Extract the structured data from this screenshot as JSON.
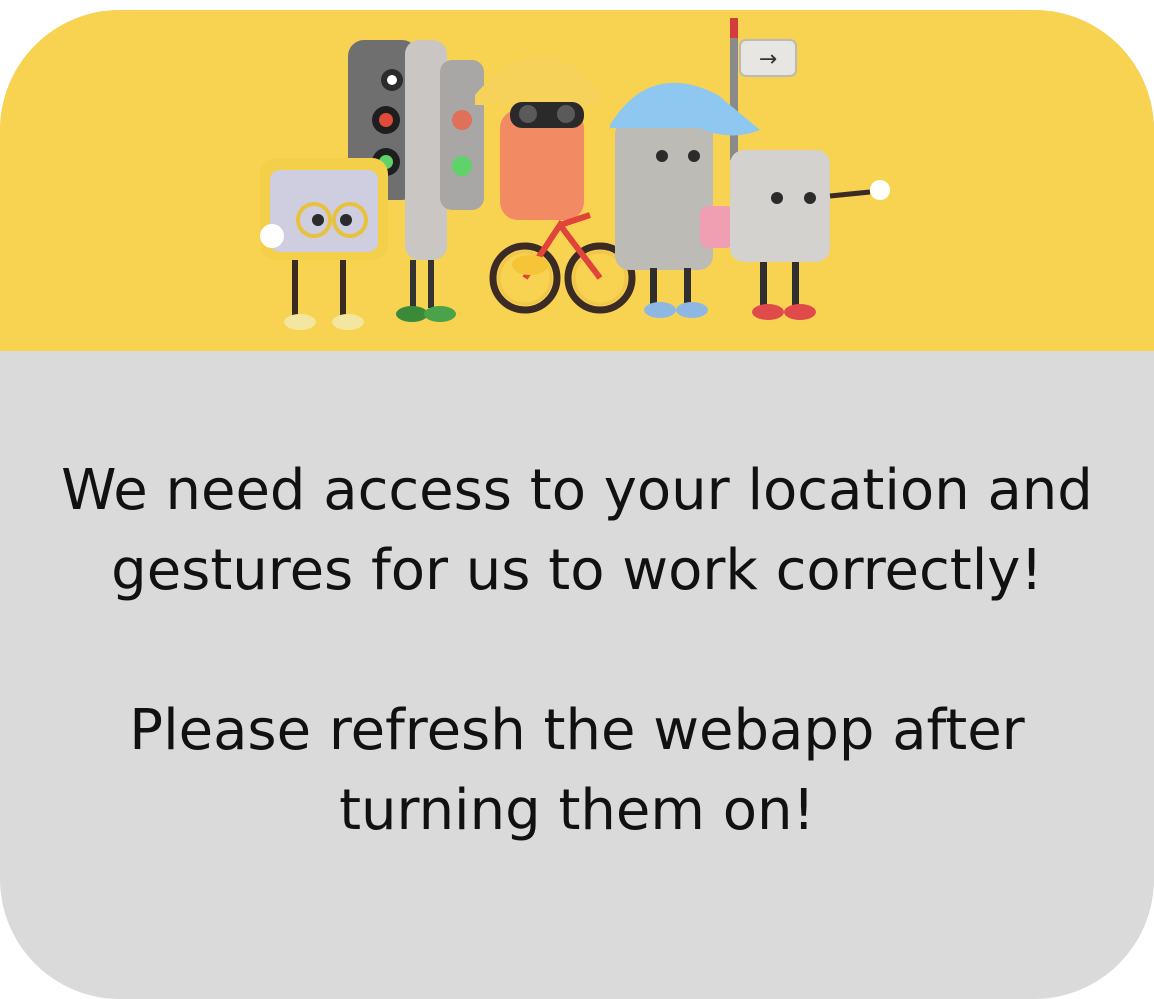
{
  "dialog": {
    "message_line_1": "We need access to your location and",
    "message_line_2": "gestures for us to work correctly!",
    "message_line_3": "Please refresh the webapp after",
    "message_line_4": "turning them on!"
  },
  "banner": {
    "illustration": "traffic-mascots-illustration",
    "sign_arrow": "→"
  },
  "colors": {
    "banner_background": "#f7d351",
    "card_background": "#dadada",
    "text": "#111111"
  }
}
